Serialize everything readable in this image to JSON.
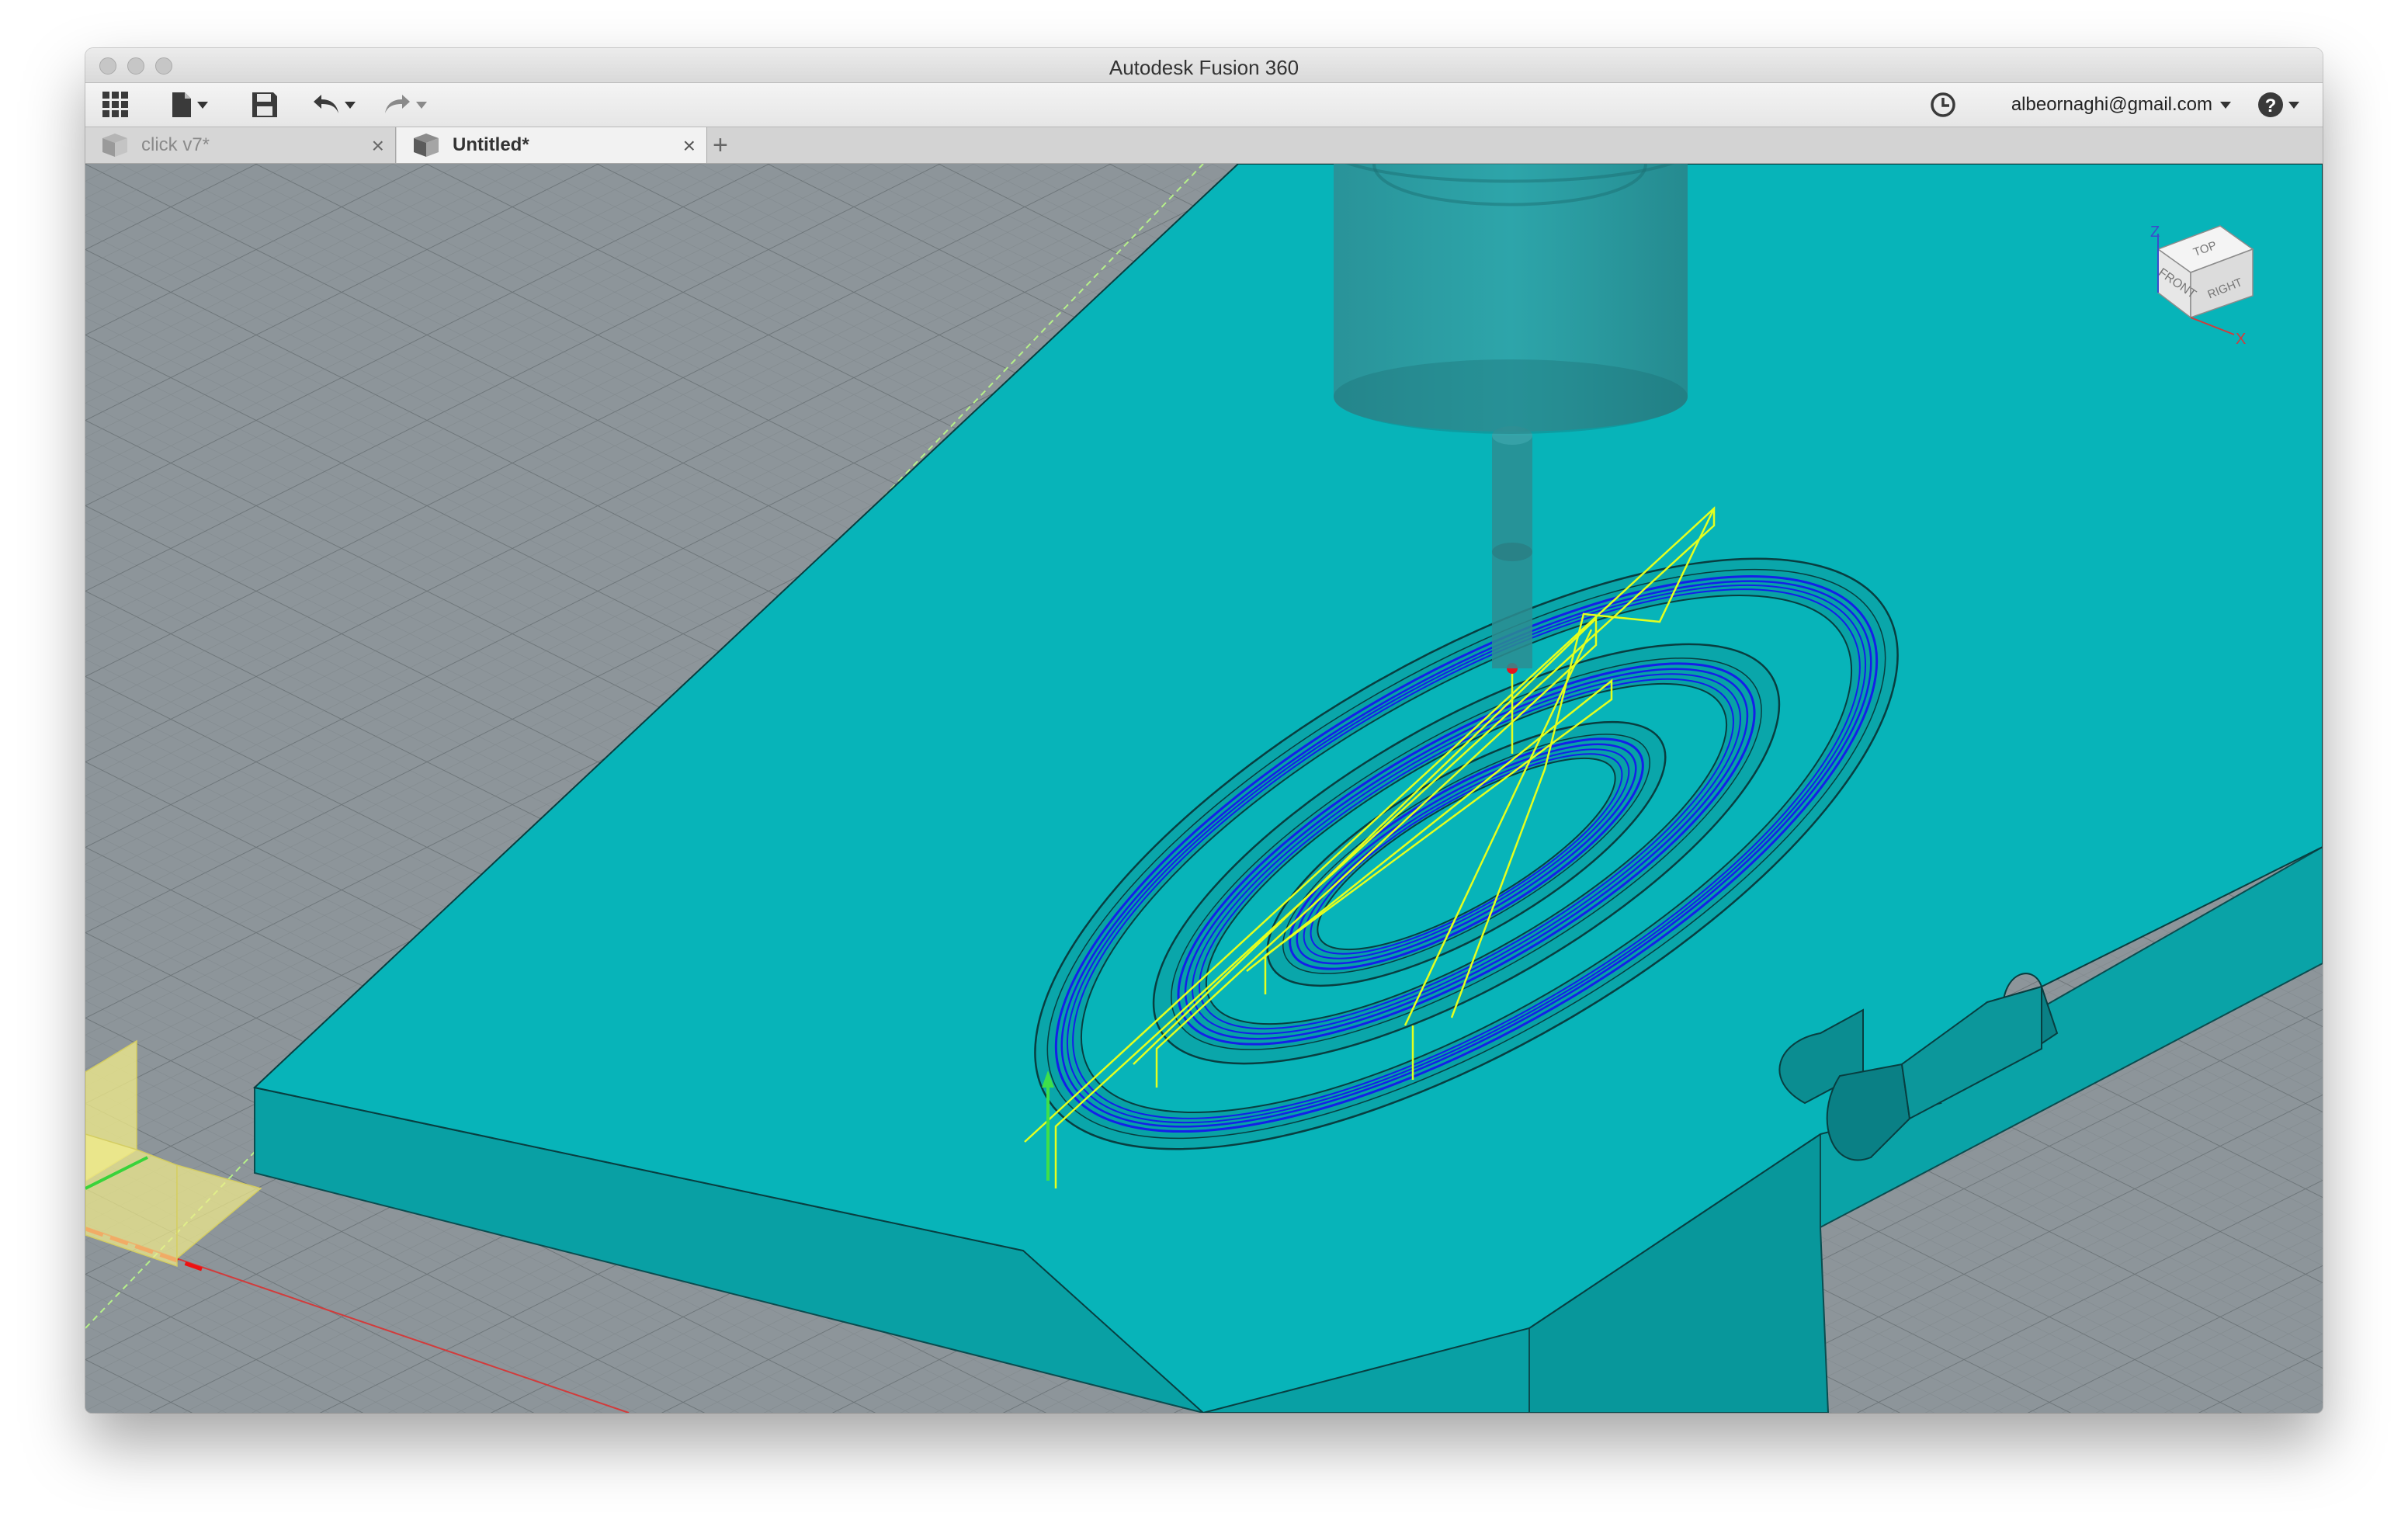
{
  "window": {
    "title": "Autodesk Fusion 360"
  },
  "toolbar": {
    "icons": [
      "grid-menu-icon",
      "file-icon",
      "save-icon",
      "undo-icon",
      "redo-icon",
      "history-icon",
      "help-icon"
    ],
    "user_email": "albeornaghi@gmail.com"
  },
  "tabs": [
    {
      "label": "click v7*",
      "active": false
    },
    {
      "label": "Untitled*",
      "active": true
    }
  ],
  "viewcube": {
    "top": "TOP",
    "front": "FRONT",
    "right": "RIGHT",
    "axis_z": "Z",
    "axis_x": "X"
  },
  "colors": {
    "stock": "#07b4b9",
    "stock_side": "#099da1",
    "toolpath_cut": "#1420e8",
    "toolpath_link": "#e4ff1f",
    "grid_bg": "#8d959a"
  }
}
